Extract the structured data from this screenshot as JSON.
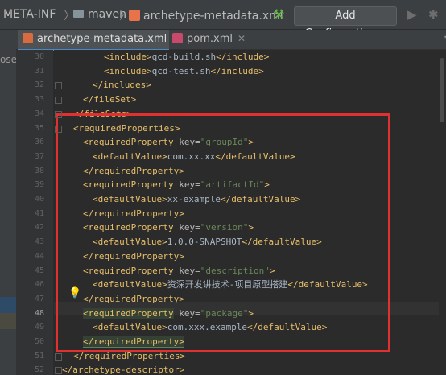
{
  "breadcrumb": {
    "folder1": "META-INF",
    "folder2": "maven",
    "file": "archetype-metadata.xml"
  },
  "toolbar": {
    "add_config_label": "Add Configuration..."
  },
  "left_strip": {
    "label": "ose"
  },
  "tabs": [
    {
      "label": "archetype-metadata.xml",
      "active": true
    },
    {
      "label": "pom.xml",
      "active": false
    }
  ],
  "editor": {
    "current_line": 48,
    "lines": [
      {
        "n": "30",
        "s": [
          [
            "tag",
            "<include>"
          ],
          [
            "text",
            "qcd-build.sh"
          ],
          [
            "tag",
            "</include>"
          ]
        ]
      },
      {
        "n": "31",
        "s": [
          [
            "tag",
            "<include>"
          ],
          [
            "text",
            "qcd-test.sh"
          ],
          [
            "tag",
            "</include>"
          ]
        ]
      },
      {
        "n": "32",
        "s": [
          [
            "tag",
            "</includes>"
          ]
        ]
      },
      {
        "n": "33",
        "s": [
          [
            "tag",
            "</fileSet>"
          ]
        ]
      },
      {
        "n": "34",
        "s": [
          [
            "tag",
            "</fileSets>"
          ]
        ]
      },
      {
        "n": "35",
        "s": [
          [
            "tag",
            "<requiredProperties>"
          ]
        ]
      },
      {
        "n": "36",
        "s": [
          [
            "tag",
            "<requiredProperty "
          ],
          [
            "attr",
            "key="
          ],
          [
            "val",
            "\"groupId\""
          ],
          [
            "tag",
            ">"
          ]
        ]
      },
      {
        "n": "37",
        "s": [
          [
            "tag",
            "<defaultValue>"
          ],
          [
            "text",
            "com.xx.xx"
          ],
          [
            "tag",
            "</defaultValue>"
          ]
        ]
      },
      {
        "n": "38",
        "s": [
          [
            "tag",
            "</requiredProperty>"
          ]
        ]
      },
      {
        "n": "39",
        "s": [
          [
            "tag",
            "<requiredProperty "
          ],
          [
            "attr",
            "key="
          ],
          [
            "val",
            "\"artifactId\""
          ],
          [
            "tag",
            ">"
          ]
        ]
      },
      {
        "n": "40",
        "s": [
          [
            "tag",
            "<defaultValue>"
          ],
          [
            "text",
            "xx-example"
          ],
          [
            "tag",
            "</defaultValue>"
          ]
        ]
      },
      {
        "n": "41",
        "s": [
          [
            "tag",
            "</requiredProperty>"
          ]
        ]
      },
      {
        "n": "42",
        "s": [
          [
            "tag",
            "<requiredProperty "
          ],
          [
            "attr",
            "key="
          ],
          [
            "val",
            "\"version\""
          ],
          [
            "tag",
            ">"
          ]
        ]
      },
      {
        "n": "43",
        "s": [
          [
            "tag",
            "<defaultValue>"
          ],
          [
            "text",
            "1.0.0-SNAPSHOT"
          ],
          [
            "tag",
            "</defaultValue>"
          ]
        ]
      },
      {
        "n": "44",
        "s": [
          [
            "tag",
            "</requiredProperty>"
          ]
        ]
      },
      {
        "n": "45",
        "s": [
          [
            "tag",
            "<requiredProperty "
          ],
          [
            "attr",
            "key="
          ],
          [
            "val",
            "\"description\""
          ],
          [
            "tag",
            ">"
          ]
        ]
      },
      {
        "n": "46",
        "s": [
          [
            "tag",
            "<defaultValue>"
          ],
          [
            "text",
            "资深开发讲技术-项目原型搭建"
          ],
          [
            "tag",
            "</defaultValue>"
          ]
        ]
      },
      {
        "n": "47",
        "s": [
          [
            "tag",
            "</requiredProperty>"
          ]
        ]
      },
      {
        "n": "48",
        "s": [
          [
            "match",
            "<requiredProperty"
          ],
          [
            "tag",
            " "
          ],
          [
            "attr",
            "key="
          ],
          [
            "val",
            "\"package\""
          ],
          [
            "tag",
            ">"
          ]
        ]
      },
      {
        "n": "49",
        "s": [
          [
            "tag",
            "<defaultValue>"
          ],
          [
            "text",
            "com.xxx.example"
          ],
          [
            "tag",
            "</defaultValue>"
          ]
        ]
      },
      {
        "n": "50",
        "s": [
          [
            "match",
            "</requiredProperty>"
          ]
        ]
      },
      {
        "n": "51",
        "s": [
          [
            "tag",
            "</requiredProperties>"
          ]
        ]
      },
      {
        "n": "52",
        "s": [
          [
            "tag",
            "</archetype-descriptor>"
          ]
        ]
      }
    ]
  },
  "colors": {
    "tag": "#e8bf6a",
    "attr": "#bababa",
    "value": "#6a8759",
    "text": "#a9b7c6",
    "highlight_box": "#e03030"
  }
}
